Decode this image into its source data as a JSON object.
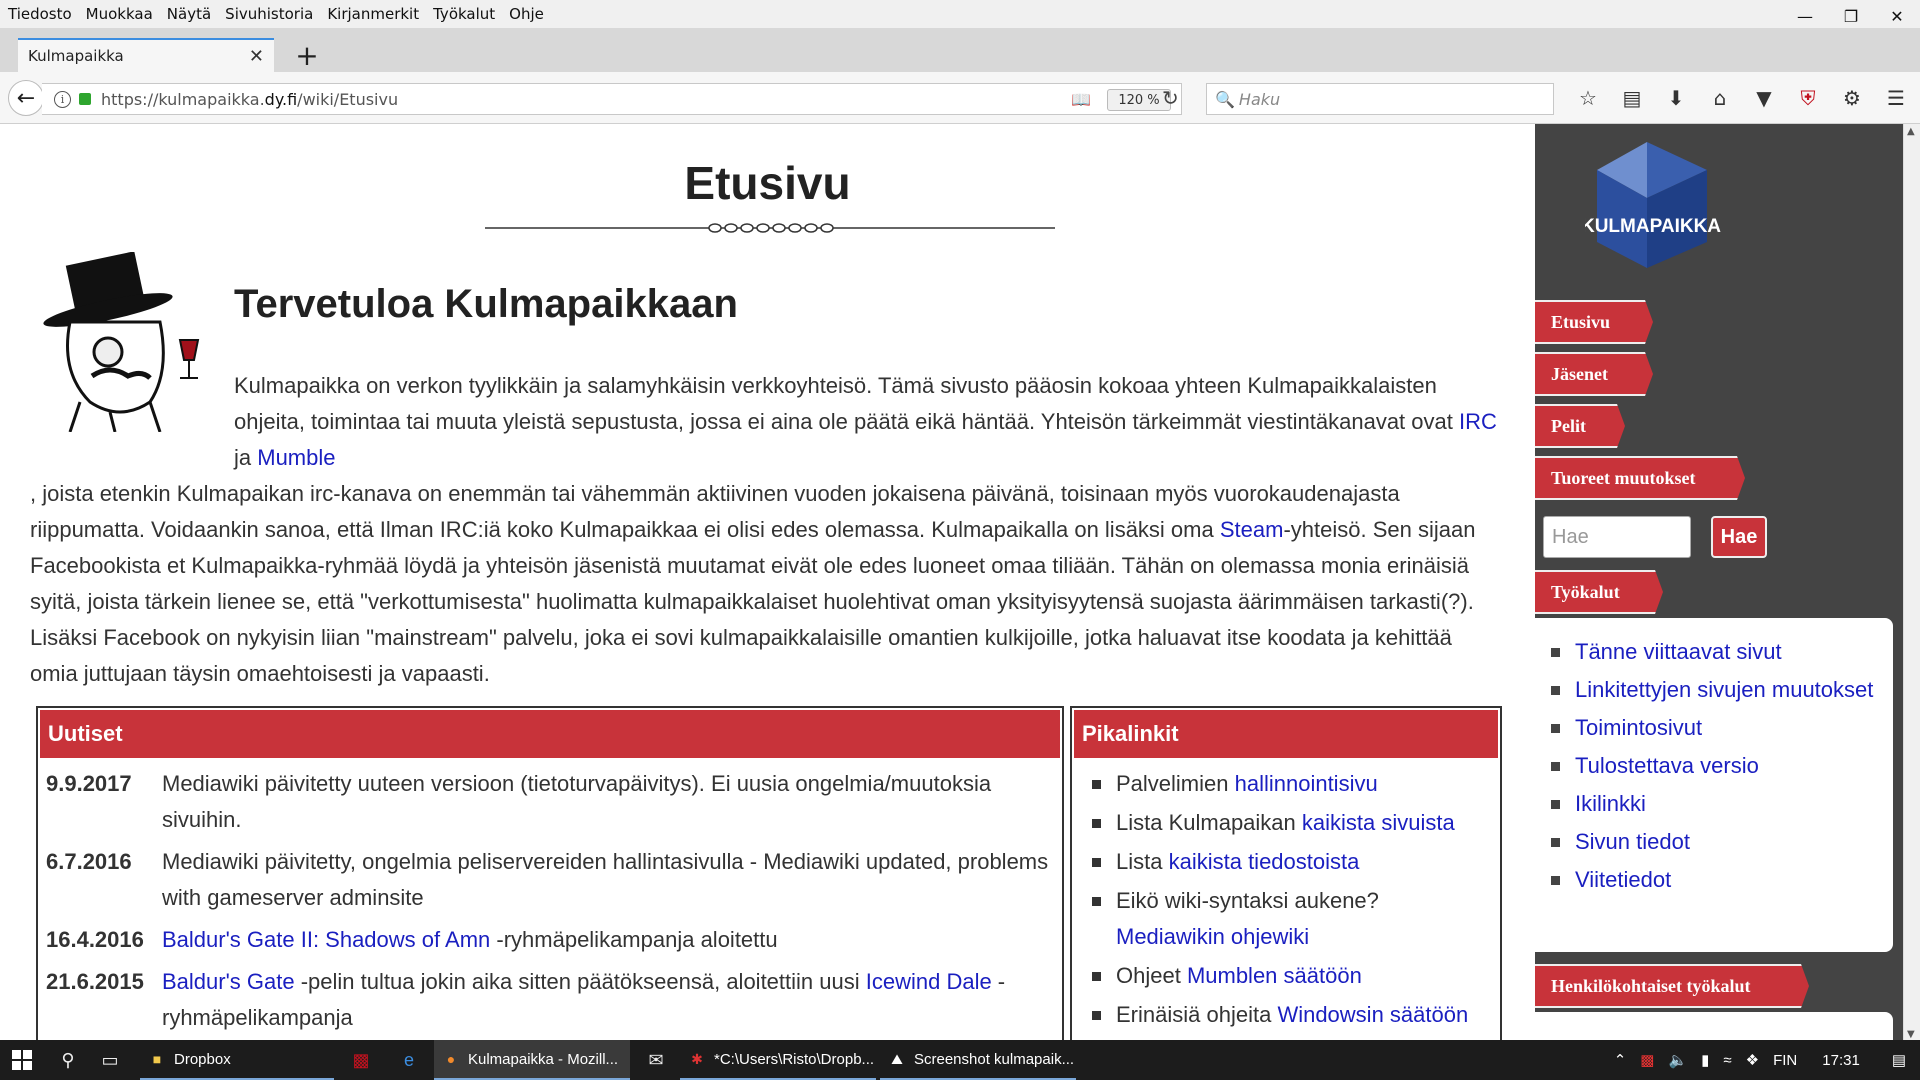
{
  "menu": [
    "Tiedosto",
    "Muokkaa",
    "Näytä",
    "Sivuhistoria",
    "Kirjanmerkit",
    "Työkalut",
    "Ohje"
  ],
  "tab": {
    "title": "Kulmapaikka"
  },
  "url": {
    "prefix": "https://kulmapaikka.",
    "domain": "dy.fi",
    "path": "/wiki/Etusivu"
  },
  "zoom": "120 %",
  "search": {
    "placeholder": "Haku"
  },
  "page": {
    "title": "Etusivu",
    "welcome": "Tervetuloa Kulmapaikkaan",
    "intro": {
      "p1": "Kulmapaikka on verkon tyylikkäin ja salamyhkäisin verkkoyhteisö. Tämä sivusto pääosin kokoaa yhteen Kulmapaikkalaisten ohjeita, toimintaa tai muuta yleistä sepustusta, jossa ei aina ole päätä eikä häntää. Yhteisön tärkeimmät viestintäkanavat ovat ",
      "irc": "IRC",
      "ja": " ja ",
      "mumble": "Mumble",
      "p2": ", joista etenkin Kulmapaikan irc-kanava on enemmän tai vähemmän aktiivinen vuoden jokaisena päivänä, toisinaan myös vuorokaudenajasta riippumatta. Voidaankin sanoa, että Ilman IRC:iä koko Kulmapaikkaa ei olisi edes olemassa. Kulmapaikalla on lisäksi oma ",
      "steam": "Steam",
      "p3": "-yhteisö. Sen sijaan Facebookista et Kulmapaikka-ryhmää löydä ja yhteisön jäsenistä muutamat eivät ole edes luoneet omaa tiliään. Tähän on olemassa monia erinäisiä syitä, joista tärkein lienee se, että \"verkottumisesta\" huolimatta kulmapaikkalaiset huolehtivat oman yksityisyytensä suojasta äärimmäisen tarkasti(?). Lisäksi Facebook on nykyisin liian \"mainstream\" palvelu, joka ei sovi kulmapaikkalaisille omantien kulkijoille, jotka haluavat itse koodata ja kehittää omia juttujaan täysin omaehtoisesti ja vapaasti."
    },
    "news": {
      "header": "Uutiset",
      "items": [
        {
          "date": "9.9.2017",
          "text": "Mediawiki päivitetty uuteen versioon (tietoturvapäivitys). Ei uusia ongelmia/muutoksia sivuihin."
        },
        {
          "date": "6.7.2016",
          "text": "Mediawiki päivitetty, ongelmia peliservereiden hallintasivulla - Mediawiki updated, problems with gameserver adminsite"
        },
        {
          "date": "16.4.2016",
          "link": "Baldur's Gate II: Shadows of Amn",
          "text": " -ryhmäpelikampanja aloitettu"
        },
        {
          "date": "21.6.2015",
          "link": "Baldur's Gate",
          "text": " -pelin tultua jokin aika sitten päätökseensä, aloitettiin uusi ",
          "link2": "Icewind Dale",
          "text2": " -ryhmäpelikampanja"
        }
      ]
    },
    "quick": {
      "header": "Pikalinkit",
      "items": [
        {
          "pre": "Palvelimien ",
          "link": "hallinnointisivu"
        },
        {
          "pre": "Lista Kulmapaikan ",
          "link": "kaikista sivuista"
        },
        {
          "pre": "Lista ",
          "link": "kaikista tiedostoista"
        },
        {
          "pre": "Eikö wiki-syntaksi aukene? ",
          "link": "Mediawikin ohjewiki"
        },
        {
          "pre": "Ohjeet ",
          "link": "Mumblen säätöön"
        },
        {
          "pre": "Erinäisiä ohjeita ",
          "link": "Windowsin säätöön"
        }
      ]
    }
  },
  "sidebar": {
    "logo_text": "KULMAPAIKKA",
    "nav": [
      "Etusivu",
      "Jäsenet",
      "Pelit",
      "Tuoreet muutokset"
    ],
    "search_placeholder": "Hae",
    "search_button": "Hae",
    "tools_label": "Työkalut",
    "tools": [
      "Tänne viittaavat sivut",
      "Linkitettyjen sivujen muutokset",
      "Toimintosivut",
      "Tulostettava versio",
      "Ikilinkki",
      "Sivun tiedot",
      "Viitetiedot"
    ],
    "personal_label": "Henkilökohtaiset työkalut"
  },
  "taskbar": {
    "apps": [
      "Dropbox",
      "Kulmapaikka - Mozill...",
      "*C:\\Users\\Risto\\Dropb...",
      "Screenshot kulmapaik..."
    ],
    "lang": "FIN",
    "time": "17:31"
  },
  "colors": {
    "accent": "#c8333a",
    "sidebar_bg": "#444444",
    "link": "#1a1fc0"
  }
}
